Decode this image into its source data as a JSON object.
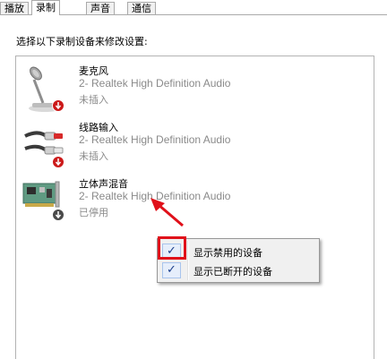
{
  "tabs": [
    {
      "label": "播放"
    },
    {
      "label": "录制"
    },
    {
      "label": "声音"
    },
    {
      "label": "通信"
    }
  ],
  "prompt": "选择以下录制设备来修改设置:",
  "devices": [
    {
      "name": "麦克风",
      "driver": "2- Realtek High Definition Audio",
      "status": "未插入",
      "icon": "microphone-icon"
    },
    {
      "name": "线路输入",
      "driver": "2- Realtek High Definition Audio",
      "status": "未插入",
      "icon": "line-in-cable-icon"
    },
    {
      "name": "立体声混音",
      "driver": "2- Realtek High Definition Audio",
      "status": "已停用",
      "icon": "sound-card-icon"
    }
  ],
  "context_menu": {
    "items": [
      {
        "label": "显示禁用的设备",
        "checked": true
      },
      {
        "label": "显示已断开的设备",
        "checked": true
      }
    ]
  },
  "annotations": {
    "highlight_color": "#e0101a",
    "arrow_color": "#e0101a"
  }
}
